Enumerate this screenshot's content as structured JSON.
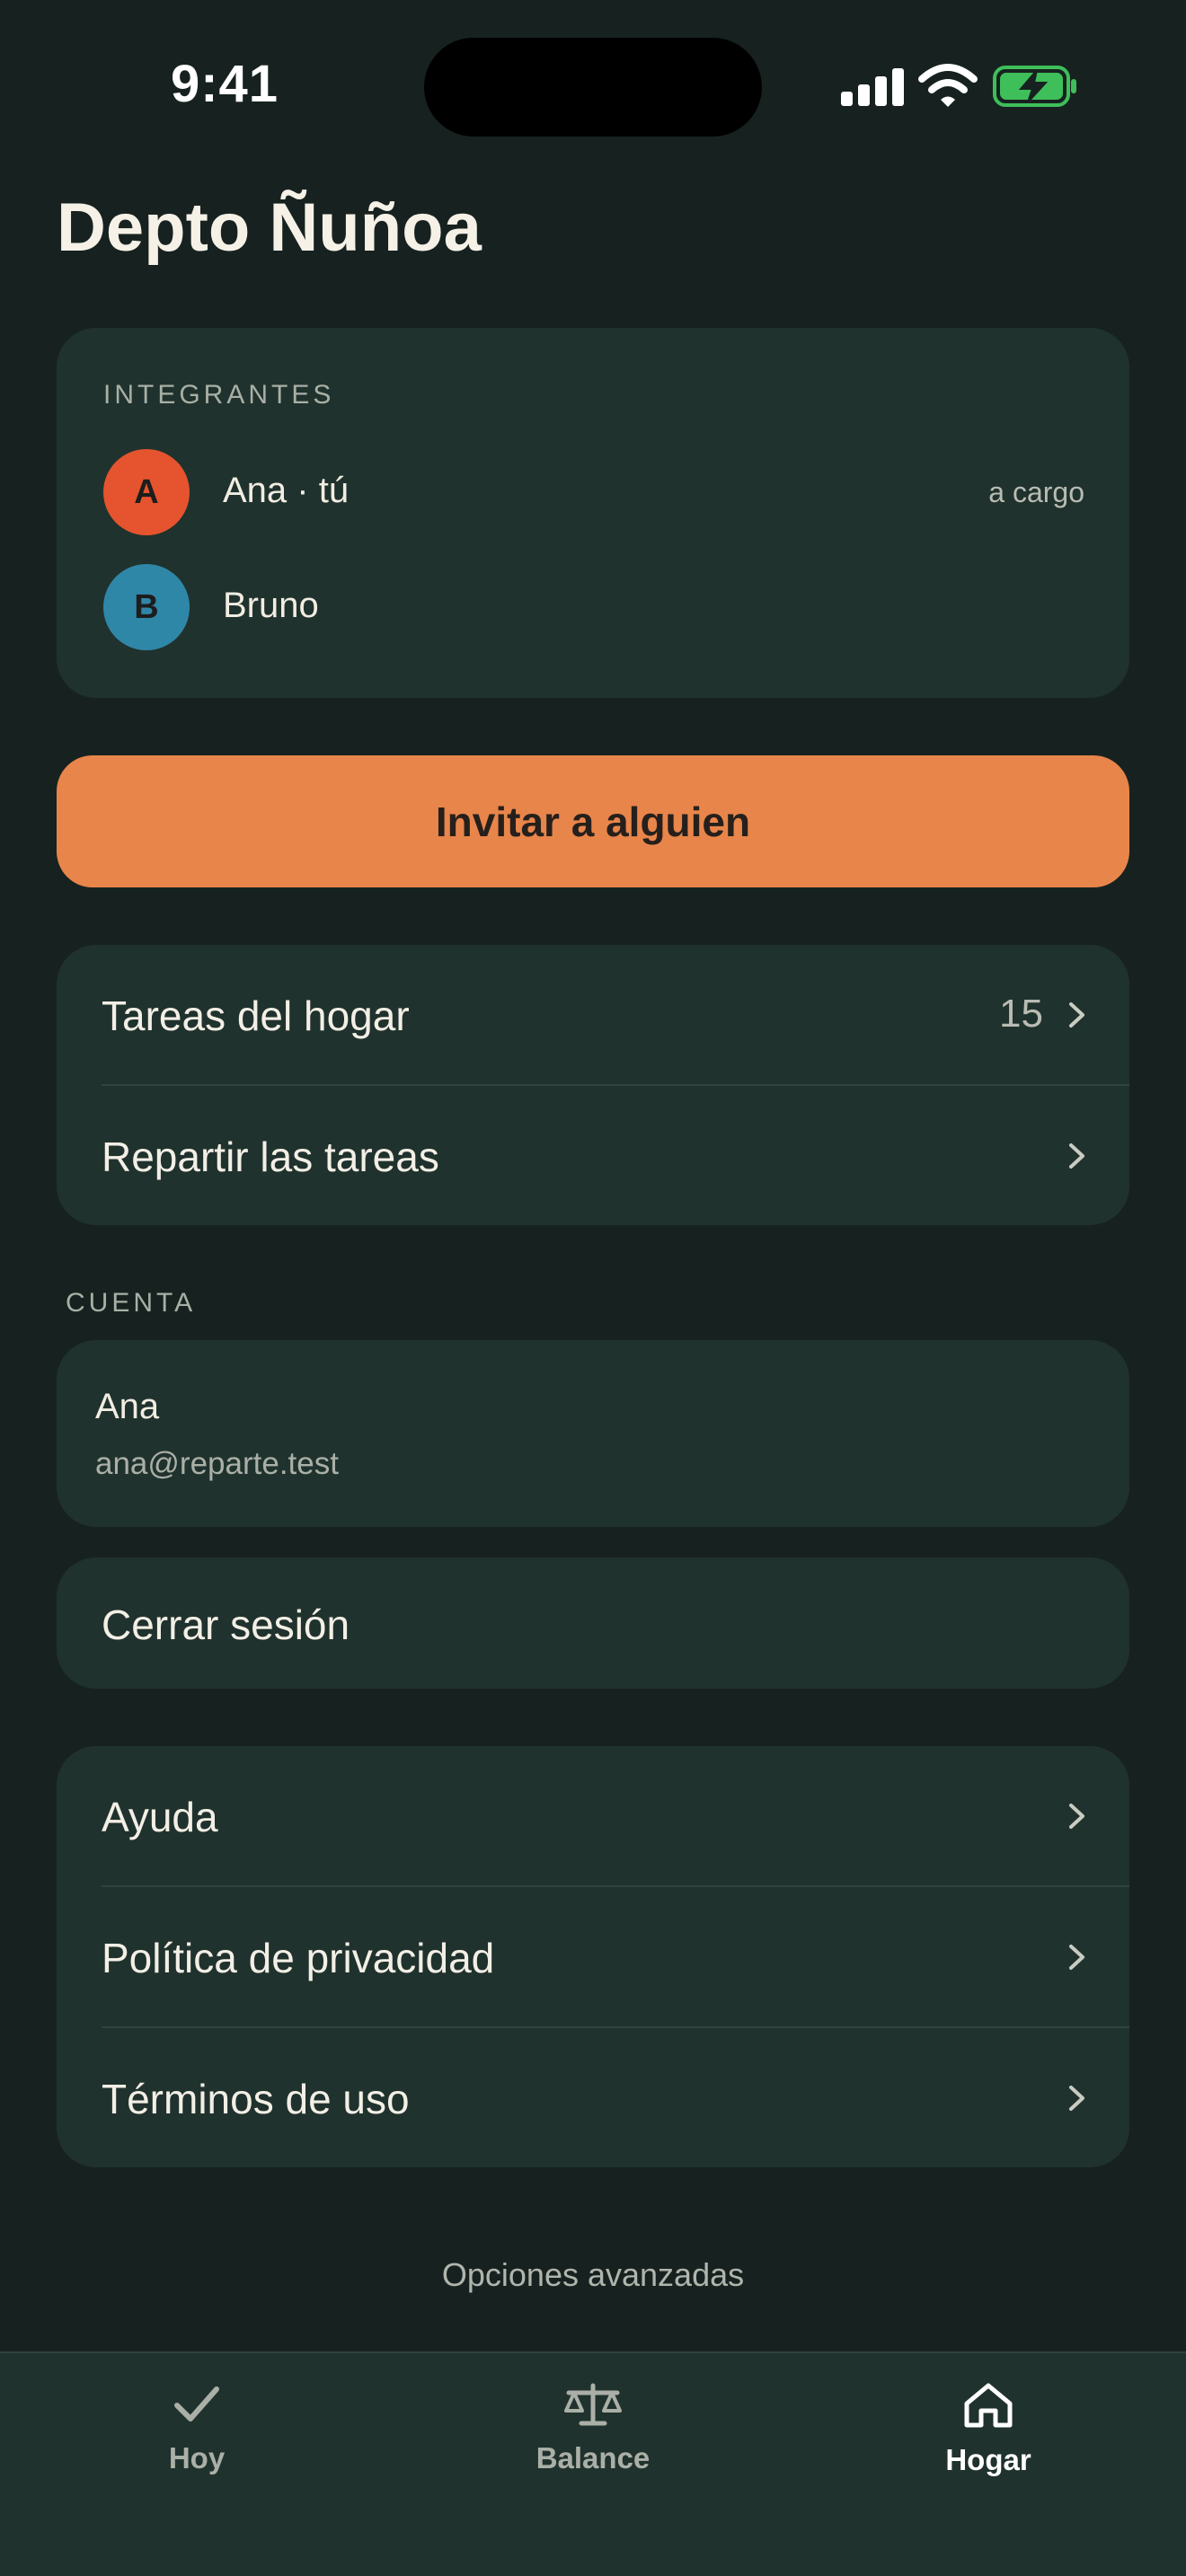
{
  "status_bar": {
    "time": "9:41",
    "icons": [
      "signal-icon",
      "wifi-icon",
      "battery-charging-icon"
    ]
  },
  "page": {
    "title": "Depto Ñuñoa"
  },
  "members": {
    "section_label": "INTEGRANTES",
    "items": [
      {
        "initial": "A",
        "name": "Ana · tú",
        "role": "a cargo",
        "color": "#e5542e"
      },
      {
        "initial": "B",
        "name": "Bruno",
        "role": "",
        "color": "#2f87a8"
      }
    ]
  },
  "invite_button": {
    "label": "Invitar a alguien",
    "color": "#e8854a"
  },
  "tasks": {
    "items": [
      {
        "label": "Tareas del hogar",
        "count": "15"
      },
      {
        "label": "Repartir las tareas",
        "count": ""
      }
    ]
  },
  "account": {
    "section_label": "CUENTA",
    "name": "Ana",
    "email": "ana@reparte.test",
    "logout_label": "Cerrar sesión"
  },
  "help": {
    "items": [
      {
        "label": "Ayuda"
      },
      {
        "label": "Política de privacidad"
      },
      {
        "label": "Términos de uso"
      }
    ]
  },
  "advanced_link": "Opciones avanzadas",
  "tab_bar": {
    "tabs": [
      {
        "label": "Hoy",
        "icon": "checkmark-icon",
        "active": false
      },
      {
        "label": "Balance",
        "icon": "scale-icon",
        "active": false
      },
      {
        "label": "Hogar",
        "icon": "home-icon",
        "active": true
      }
    ]
  },
  "colors": {
    "background": "#172220",
    "card": "#20322d",
    "accent": "#e8854a"
  }
}
